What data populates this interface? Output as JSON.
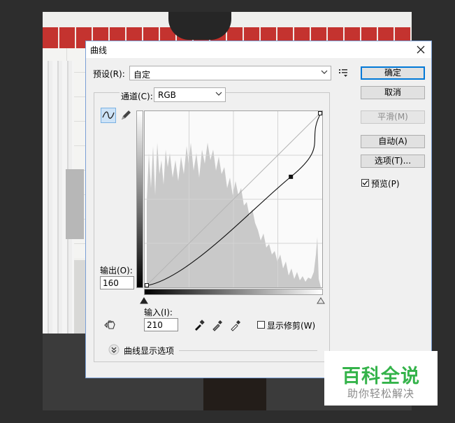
{
  "dialog": {
    "title": "曲线",
    "close_label": "✕",
    "preset_label": "预设(R):",
    "preset_value": "自定",
    "channel_label": "通道(C):",
    "channel_value": "RGB",
    "output_label": "输出(O):",
    "output_value": "160",
    "input_label": "输入(I):",
    "input_value": "210",
    "show_clipping_label": "显示修剪(W)",
    "show_clipping_checked": false,
    "curve_display_options_label": "曲线显示选项",
    "buttons": {
      "ok": "确定",
      "cancel": "取消",
      "smooth": "平滑(M)",
      "auto": "自动(A)",
      "options": "选项(T)..."
    },
    "preview_label": "预览(P)",
    "preview_checked": true,
    "curve_point": {
      "input": 210,
      "output": 160
    }
  },
  "watermark": {
    "main": "百科全说",
    "sub": "助你轻松解决"
  },
  "colors": {
    "accent": "#0078d7",
    "watermark_green": "#34b34a",
    "histogram": "#c9c9c9"
  },
  "icons": [
    "close-icon",
    "preset-menu-icon",
    "curve-point-tool-icon",
    "pencil-icon",
    "hand-adjust-icon",
    "black-eyedropper-icon",
    "gray-eyedropper-icon",
    "white-eyedropper-icon",
    "expand-chevron-icon",
    "chevron-down-icon"
  ]
}
